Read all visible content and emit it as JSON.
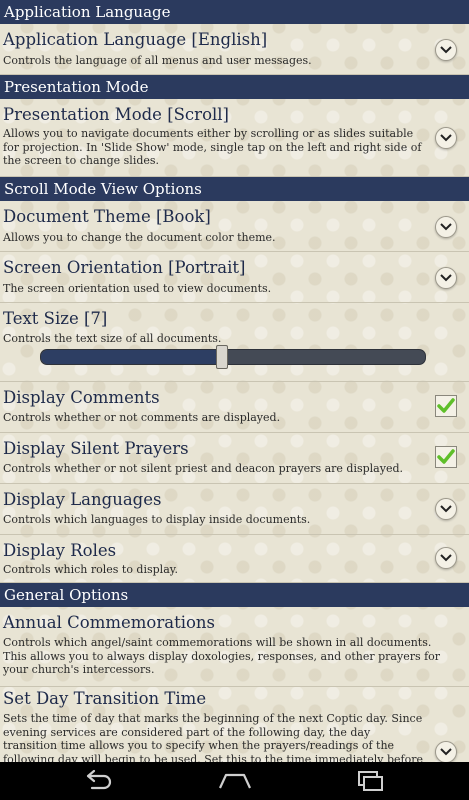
{
  "sections": {
    "application_language": "Application Language",
    "presentation_mode": "Presentation Mode",
    "scroll_mode_view_options": "Scroll Mode View Options",
    "general_options": "General Options"
  },
  "prefs": {
    "app_language": {
      "title": "Application Language [English]",
      "summary": "Controls the language of all menus and user messages."
    },
    "presentation_mode": {
      "title": "Presentation Mode [Scroll]",
      "summary": "Allows you to navigate documents either by scrolling or as slides suitable for projection.  In 'Slide Show' mode, single tap on the left and right side of the screen to change slides."
    },
    "document_theme": {
      "title": "Document Theme [Book]",
      "summary": "Allows you to change the document color theme."
    },
    "screen_orientation": {
      "title": "Screen Orientation [Portrait]",
      "summary": "The screen orientation used to view documents."
    },
    "text_size": {
      "title": "Text Size [7]",
      "summary": "Controls the text size of all documents.",
      "level_fraction": 0.47
    },
    "display_comments": {
      "title": "Display Comments",
      "summary": "Controls whether or not comments are displayed.",
      "checked": true
    },
    "display_silent_prayers": {
      "title": "Display Silent Prayers",
      "summary": "Controls whether or not silent priest and deacon prayers are displayed.",
      "checked": true
    },
    "display_languages": {
      "title": "Display Languages",
      "summary": "Controls which languages to display inside documents."
    },
    "display_roles": {
      "title": "Display Roles",
      "summary": "Controls which roles to display."
    },
    "annual_commemorations": {
      "title": "Annual Commemorations",
      "summary": "Controls which angel/saint commemorations will be shown in all documents.  This allows you to always display doxologies, responses, and other prayers for your church's intercessors."
    },
    "set_day_transition": {
      "title": "Set Day Transition Time",
      "summary": "Sets the time of day that marks the beginning of the next Coptic day.  Since evening services are considered part of the following day, the day transition time allows you to specify when the prayers/readings of the following day will begin to be used. Set this to the time immediately before H"
    }
  },
  "icons": {
    "dropdown": "chevron-down-icon",
    "check": "checkmark-icon",
    "back": "back-icon",
    "home": "home-icon",
    "recents": "recent-apps-icon"
  },
  "colors": {
    "header_bg": "#2b3a5e",
    "title_text": "#1e2a4a",
    "check_green": "#5fbf2a"
  }
}
